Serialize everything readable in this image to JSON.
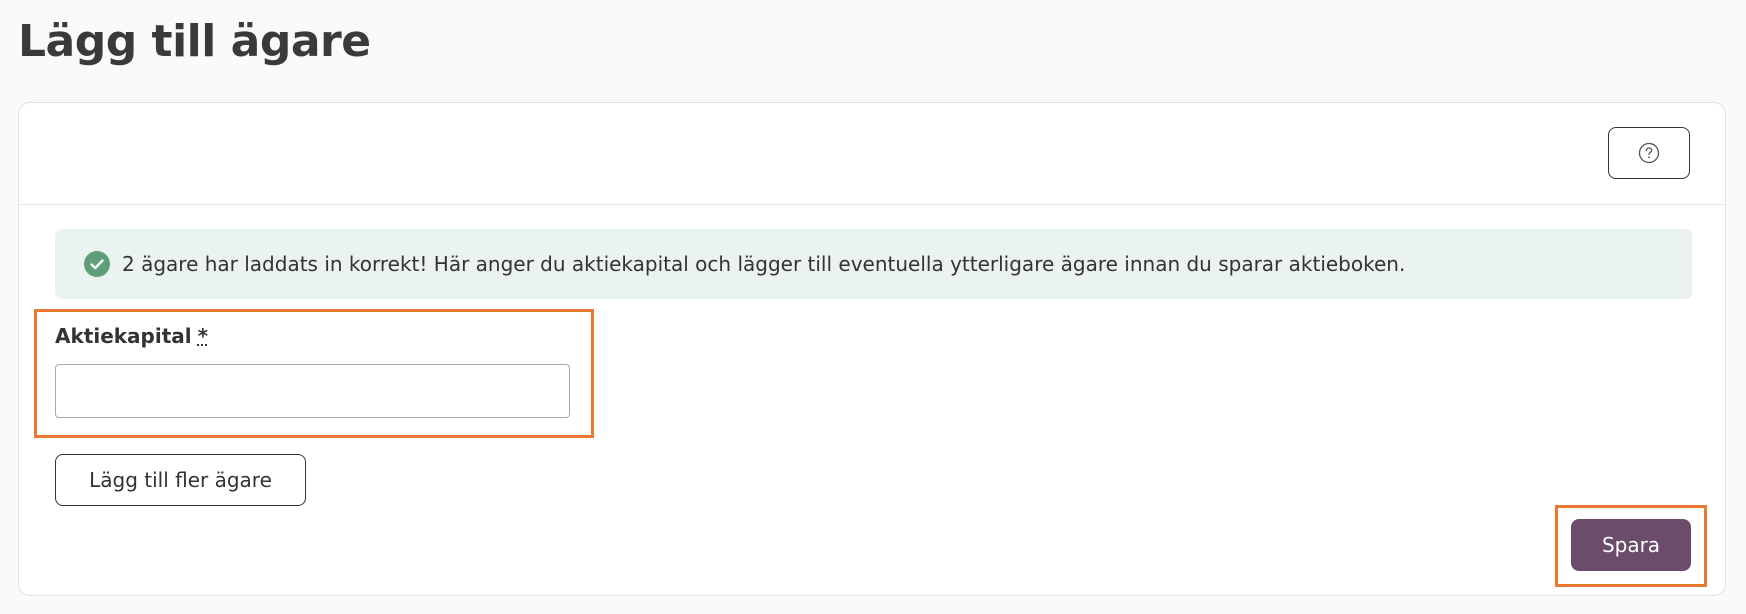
{
  "page": {
    "title": "Lägg till ägare"
  },
  "header": {
    "help_icon": "question-circle-icon"
  },
  "alert": {
    "icon": "check-circle-icon",
    "text": "2 ägare har laddats in korrekt! Här anger du aktiekapital och lägger till eventuella ytterligare ägare innan du sparar aktieboken."
  },
  "form": {
    "capital_label": "Aktiekapital",
    "required_mark": "*",
    "capital_value": "",
    "add_owner_label": "Lägg till fler ägare",
    "save_label": "Spara"
  },
  "colors": {
    "accent": "#6b4c6a",
    "success": "#5e9e78",
    "alert_bg": "#eaf3ee",
    "highlight": "#ea7a30"
  }
}
